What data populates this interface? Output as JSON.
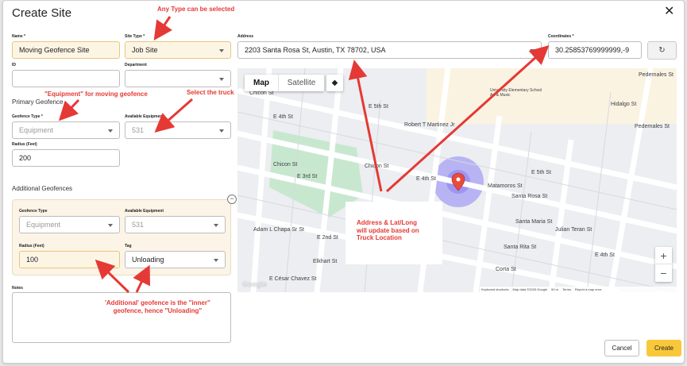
{
  "dialog": {
    "title": "Create Site",
    "close_glyph": "✕"
  },
  "form": {
    "name": {
      "label": "Name *",
      "value": "Moving Geofence Site"
    },
    "site_type": {
      "label": "Site Type *",
      "value": "Job Site"
    },
    "address": {
      "label": "Address",
      "value": "2203 Santa Rosa St, Austin, TX 78702, USA"
    },
    "coordinates": {
      "label": "Coordinates *",
      "value": "30.25853769999999,-9"
    },
    "id": {
      "label": "ID",
      "value": ""
    },
    "department": {
      "label": "Department",
      "value": ""
    },
    "primary": {
      "heading": "Primary Geofence",
      "geofence_type": {
        "label": "Geofence Type *",
        "value": "Equipment"
      },
      "available_equipment": {
        "label": "Available Equipment",
        "value": "531"
      },
      "radius": {
        "label": "Radius (Feet)",
        "value": "200"
      }
    },
    "additional": {
      "heading": "Additional Geofences",
      "remove_glyph": "−",
      "geofence_type": {
        "label": "Geofence Type",
        "value": "Equipment"
      },
      "available_equipment": {
        "label": "Available Equipment",
        "value": "531"
      },
      "radius": {
        "label": "Radius (Feet)",
        "value": "100"
      },
      "tag": {
        "label": "Tag",
        "value": "Unloading"
      }
    },
    "notes": {
      "label": "Notes",
      "value": ""
    },
    "refresh_glyph": "↻"
  },
  "map": {
    "tab_map": "Map",
    "tab_satellite": "Satellite",
    "layers_glyph": "◆",
    "zoom_in": "+",
    "zoom_out": "−",
    "logo": "Google",
    "footer": {
      "shortcuts": "Keyboard shortcuts",
      "data": "Map data ©2025 Google",
      "scale": "50 m",
      "terms": "Terms",
      "report": "Report a map error"
    },
    "streets": [
      "E 5th St",
      "E 4th St",
      "E 3rd St",
      "E 2nd St",
      "E 4th St",
      "E 5th St",
      "Santa Rosa St",
      "Santa Maria St",
      "Santa Rita St",
      "Corta St",
      "Chicon St",
      "Chicon St",
      "Adam L Chapa Sr St",
      "Elkhart St",
      "Robert T Martinez Jr",
      "Matamoros St",
      "Julian Teran St",
      "E César Chavez St",
      "Hidalgo St",
      "Pedernales St",
      "Pedernales St",
      "Chicon St",
      "E 4th St"
    ],
    "poi": "University Elementary School Art & Music"
  },
  "annotations": {
    "type_note": "Any Type can be selected",
    "equipment_note": "\"Equipment\" for moving geofence",
    "truck_note": "Select the truck",
    "callout_line1": "Address & Lat/Long",
    "callout_line2": "will update based on",
    "callout_line3": "Truck Location",
    "additional_note_line1": "'Additional' geofence is the \"inner\"",
    "additional_note_line2": "geofence, hence \"Unloading\""
  },
  "actions": {
    "cancel": "Cancel",
    "create": "Create"
  },
  "colors": {
    "accent": "#f9c83a",
    "annotation_red": "#e53935",
    "geofence": "#7b6cf6"
  }
}
